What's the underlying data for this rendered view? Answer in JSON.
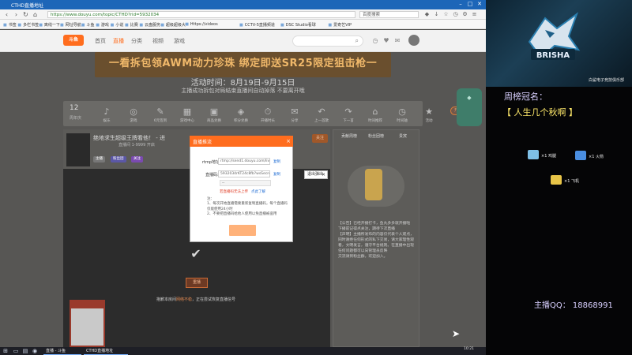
{
  "browser": {
    "window_title": "CTHD直播地址",
    "url": "https://www.douyu.com/topic/CTHD?rid=5932034",
    "search_placeholder": "百度搜索",
    "bookmarks": [
      "书签",
      "多栏书签",
      "离线一下",
      "网址导航",
      "斗鱼",
      "游戏",
      "小说",
      "比赛",
      "云盘服务",
      "超级超级大",
      "Https://videos",
      "CCTV-5直播频道",
      "DSC Studio看球",
      "爱奇艺VIP"
    ]
  },
  "site": {
    "logo": "斗鱼",
    "nav": [
      "首页",
      "直播",
      "分类",
      "视频",
      "游戏"
    ],
    "active_nav": "直播"
  },
  "banner": {
    "title": "一看拆包领AWM动力珍珠 绑定即送SR25限定狙击枪一",
    "time": "活动时间：8月19日-9月15日",
    "note": "主播成功拆包对局结束直播间自动掉落 不要离开哦"
  },
  "wheel": {
    "day": "12",
    "sub": "周年庆",
    "items": [
      "娱乐",
      "游戏",
      "6元签到",
      "游戏中心",
      "商品兑换",
      "积分兑换",
      "开播时长",
      "分享",
      "上一首歌",
      "下一首",
      "时间推荐",
      "时间轴",
      "活动"
    ],
    "gift_button": "开通粉丝卡"
  },
  "room": {
    "title": "绝地求生超级王牌看他！ - 进",
    "sub": "直播间 1-9999 开启",
    "badges": [
      "主播",
      "粉丝团",
      "关注"
    ],
    "follow": "关注",
    "replay_button": "重播",
    "tip_pre": "抱歉本房间",
    "tip_link": "网络不稳",
    "tip_post": "，正在尝试恢复直播信号"
  },
  "rank": {
    "tabs": [
      "贡献周榜",
      "粉丝团榜",
      "贵宾"
    ],
    "notice": "【公告】已经开播打卡，鱼丸多多就开播啦\n下播前记得点关注，期待下次直播\n【声明】主播所发布的内容仅代表个人观点，同时谢绝任何形式的私下交易，请大家理性观看，文明发言，遵守平台规则。在直播中出现任何问题都可以向管理员反映\n交流请到粉丝群，欢迎加入。"
  },
  "modal": {
    "title": "直播推流",
    "rtmp_label": "rtmp地址:",
    "rtmp_value": "rtmp://send1.douyu.com/live",
    "key_label": "直播码:",
    "key_value": "5932034rKT24c8fb?wsSecret=*******",
    "copy": "复制",
    "select_value": "--",
    "warn": "若直播码无法上传",
    "warn_link": "点此了解",
    "notes": "注：\n1、每次开始直播需要重新复制直播码，每个直播码仅能使用24小时\n2、不要把直播码给他人使用以免直播被盗用"
  },
  "exit_tip": {
    "label": "退出弹出"
  },
  "taskbar": {
    "app": "CTHD直播地址",
    "app2": "直播 - 斗鱼",
    "time": "10:21"
  },
  "overlay": {
    "team_name": "白鲨电子竞技俱乐部",
    "logo_text": "BRISHA",
    "weekly_label": "周榜冠名：",
    "weekly_name": "【 人生几个秋啊 】",
    "gifts": [
      {
        "label": "×1 鸡腿",
        "color": "#7fc0e6"
      },
      {
        "label": "×1 火箭",
        "color": "#4a8ee0"
      },
      {
        "label": "×1 飞机",
        "color": "#e8c548"
      }
    ],
    "qq": "主播QQ：  18868991"
  },
  "colors": {
    "brand": "#ff6d1e",
    "browser_blue": "#1d66b8",
    "overlay_purple": "#d9d0ff",
    "overlay_yellow": "#ffe96a"
  }
}
